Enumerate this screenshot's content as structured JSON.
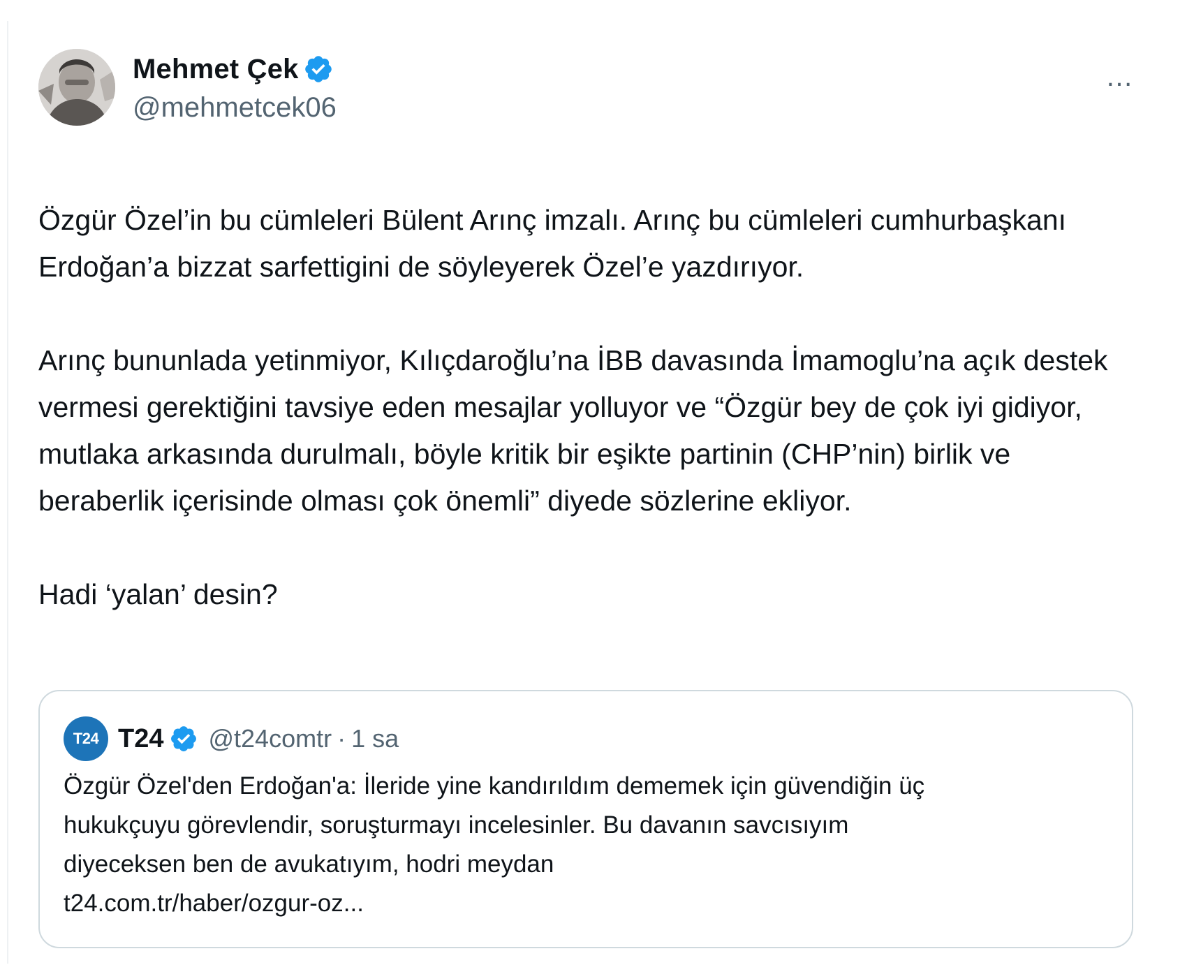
{
  "author": {
    "display_name": "Mehmet Çek",
    "handle": "@mehmetcek06",
    "verified": true
  },
  "more_icon": "…",
  "tweet": {
    "paragraphs": [
      "Özgür Özel’in bu cümleleri Bülent Arınç imzalı. Arınç bu cümleleri cumhurbaşkanı Erdoğan’a bizzat sarfettigini de söyleyerek Özel’e yazdırıyor.",
      "Arınç bununlada yetinmiyor, Kılıçdaroğlu’na İBB davasında İmamoglu’na açık destek vermesi gerektiğini tavsiye eden mesajlar yolluyor ve “Özgür bey de çok iyi gidiyor, mutlaka arkasında durulmalı, böyle kritik bir eşikte partinin (CHP’nin) birlik ve beraberlik içerisinde olması çok önemli” diyede sözlerine ekliyor.",
      "Hadi ‘yalan’ desin?"
    ]
  },
  "quoted": {
    "avatar_text": "T24",
    "display_name": "T24",
    "handle": "@t24comtr",
    "separator": "·",
    "time": "1 sa",
    "verified": true,
    "lines": [
      "Özgür Özel'den Erdoğan'a: İleride yine kandırıldım dememek için güvendiğin üç",
      "hukukçuyu görevlendir, soruşturmayı incelesinler. Bu davanın savcısıyım",
      "diyeceksen ben de avukatıyım, hodri meydan",
      "t24.com.tr/haber/ozgur-oz..."
    ]
  },
  "colors": {
    "text": "#0f1419",
    "secondary": "#536471",
    "verified_blue": "#1d9bf0",
    "border": "#cfd9de",
    "t24_blue": "#1d74b8"
  },
  "icons": {
    "verified": "verified-badge-icon",
    "more": "more-options-icon"
  }
}
